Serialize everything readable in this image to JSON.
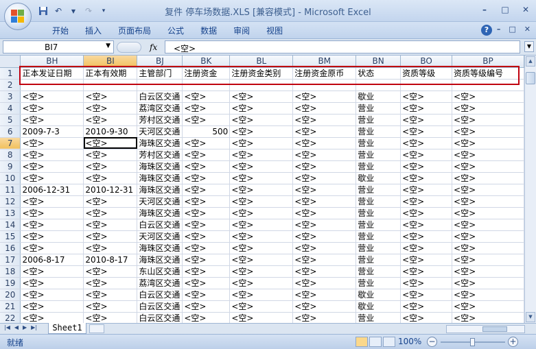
{
  "window": {
    "title": "复件 停车场数据.XLS  [兼容模式] - Microsoft Excel",
    "controls": {
      "minimize": "–",
      "maximize": "□",
      "close": "✕"
    }
  },
  "ribbon": {
    "tabs": [
      "开始",
      "插入",
      "页面布局",
      "公式",
      "数据",
      "审阅",
      "视图"
    ],
    "help": "?"
  },
  "formula_bar": {
    "name_box": "BI7",
    "fx": "fx",
    "formula": "<空>"
  },
  "columns": [
    "BH",
    "BI",
    "BJ",
    "BK",
    "BL",
    "BM",
    "BN",
    "BO",
    "BP"
  ],
  "selected_column": "BI",
  "selected_row": "7",
  "rows": [
    {
      "n": "1",
      "cells": [
        "正本发证日期",
        "正本有效期",
        "主管部门",
        "注册资金",
        "注册资金类别",
        "注册资金原币",
        "状态",
        "资质等级",
        "资质等级编号"
      ]
    },
    {
      "n": "2",
      "cells": [
        "",
        "",
        "",
        "",
        "",
        "",
        "",
        "",
        ""
      ]
    },
    {
      "n": "3",
      "cells": [
        "<空>",
        "<空>",
        "白云区交通",
        "<空>",
        "<空>",
        "<空>",
        "歇业",
        "<空>",
        "<空>"
      ]
    },
    {
      "n": "4",
      "cells": [
        "<空>",
        "<空>",
        "荔湾区交通",
        "<空>",
        "<空>",
        "<空>",
        "营业",
        "<空>",
        "<空>"
      ]
    },
    {
      "n": "5",
      "cells": [
        "<空>",
        "<空>",
        "芳村区交通",
        "<空>",
        "<空>",
        "<空>",
        "营业",
        "<空>",
        "<空>"
      ]
    },
    {
      "n": "6",
      "cells": [
        "2009-7-3",
        "2010-9-30",
        "天河区交通",
        "500",
        "<空>",
        "<空>",
        "营业",
        "<空>",
        "<空>"
      ]
    },
    {
      "n": "7",
      "cells": [
        "<空>",
        "<空>",
        "海珠区交通",
        "<空>",
        "<空>",
        "<空>",
        "营业",
        "<空>",
        "<空>"
      ]
    },
    {
      "n": "8",
      "cells": [
        "<空>",
        "<空>",
        "芳村区交通",
        "<空>",
        "<空>",
        "<空>",
        "营业",
        "<空>",
        "<空>"
      ]
    },
    {
      "n": "9",
      "cells": [
        "<空>",
        "<空>",
        "海珠区交通",
        "<空>",
        "<空>",
        "<空>",
        "营业",
        "<空>",
        "<空>"
      ]
    },
    {
      "n": "10",
      "cells": [
        "<空>",
        "<空>",
        "海珠区交通",
        "<空>",
        "<空>",
        "<空>",
        "歇业",
        "<空>",
        "<空>"
      ]
    },
    {
      "n": "11",
      "cells": [
        "2006-12-31",
        "2010-12-31",
        "海珠区交通",
        "<空>",
        "<空>",
        "<空>",
        "营业",
        "<空>",
        "<空>"
      ]
    },
    {
      "n": "12",
      "cells": [
        "<空>",
        "<空>",
        "天河区交通",
        "<空>",
        "<空>",
        "<空>",
        "营业",
        "<空>",
        "<空>"
      ]
    },
    {
      "n": "13",
      "cells": [
        "<空>",
        "<空>",
        "海珠区交通",
        "<空>",
        "<空>",
        "<空>",
        "营业",
        "<空>",
        "<空>"
      ]
    },
    {
      "n": "14",
      "cells": [
        "<空>",
        "<空>",
        "白云区交通",
        "<空>",
        "<空>",
        "<空>",
        "营业",
        "<空>",
        "<空>"
      ]
    },
    {
      "n": "15",
      "cells": [
        "<空>",
        "<空>",
        "天河区交通",
        "<空>",
        "<空>",
        "<空>",
        "营业",
        "<空>",
        "<空>"
      ]
    },
    {
      "n": "16",
      "cells": [
        "<空>",
        "<空>",
        "海珠区交通",
        "<空>",
        "<空>",
        "<空>",
        "营业",
        "<空>",
        "<空>"
      ]
    },
    {
      "n": "17",
      "cells": [
        "2006-8-17",
        "2010-8-17",
        "海珠区交通",
        "<空>",
        "<空>",
        "<空>",
        "营业",
        "<空>",
        "<空>"
      ]
    },
    {
      "n": "18",
      "cells": [
        "<空>",
        "<空>",
        "东山区交通",
        "<空>",
        "<空>",
        "<空>",
        "营业",
        "<空>",
        "<空>"
      ]
    },
    {
      "n": "19",
      "cells": [
        "<空>",
        "<空>",
        "荔湾区交通",
        "<空>",
        "<空>",
        "<空>",
        "营业",
        "<空>",
        "<空>"
      ]
    },
    {
      "n": "20",
      "cells": [
        "<空>",
        "<空>",
        "白云区交通",
        "<空>",
        "<空>",
        "<空>",
        "歇业",
        "<空>",
        "<空>"
      ]
    },
    {
      "n": "21",
      "cells": [
        "<空>",
        "<空>",
        "白云区交通",
        "<空>",
        "<空>",
        "<空>",
        "歇业",
        "<空>",
        "<空>"
      ]
    },
    {
      "n": "22",
      "cells": [
        "<空>",
        "<空>",
        "白云区交通",
        "<空>",
        "<空>",
        "<空>",
        "营业",
        "<空>",
        "<空>"
      ]
    }
  ],
  "sheet_tabs": [
    "Sheet1"
  ],
  "status": {
    "ready": "就绪",
    "zoom": "100%"
  },
  "colors": {
    "highlight_border": "#c0000e",
    "selected_header": "#f1c15f"
  }
}
